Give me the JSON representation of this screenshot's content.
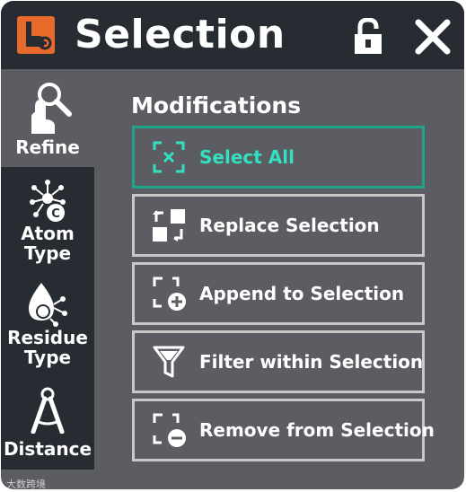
{
  "window": {
    "title": "Selection"
  },
  "header": {
    "lock_icon": "lock-open-icon",
    "close_icon": "close-icon"
  },
  "sidebar": {
    "items": [
      {
        "label": "Refine",
        "icon": "magnifier-finger-icon"
      },
      {
        "label": "Atom\nType",
        "icon": "atom-molecule-icon"
      },
      {
        "label": "Residue\nType",
        "icon": "residue-drop-icon"
      },
      {
        "label": "Distance",
        "icon": "compass-icon"
      }
    ]
  },
  "main": {
    "section_title": "Modifications",
    "buttons": [
      {
        "label": "Select All",
        "icon": "select-all-icon",
        "active": true
      },
      {
        "label": "Replace Selection",
        "icon": "replace-selection-icon",
        "active": false
      },
      {
        "label": "Append to Selection",
        "icon": "append-selection-icon",
        "active": false
      },
      {
        "label": "Filter within Selection",
        "icon": "filter-icon",
        "active": false
      },
      {
        "label": "Remove from Selection",
        "icon": "remove-selection-icon",
        "active": false
      }
    ]
  },
  "watermark": "大数跨境",
  "colors": {
    "header": "#272c32",
    "panel": "#5b5d62",
    "accent": "#1ea58c",
    "accent_text": "#33e0c0",
    "app_icon": "#e8692c"
  }
}
